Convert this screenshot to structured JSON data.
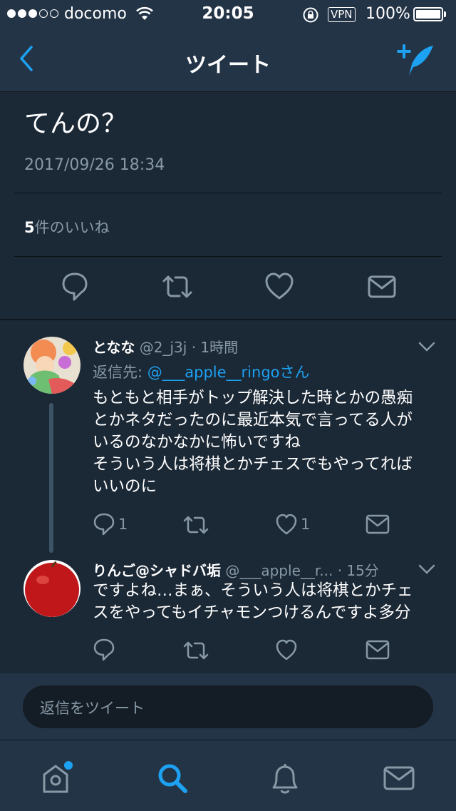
{
  "status_bar": {
    "carrier": "docomo",
    "time": "20:05",
    "vpn": "VPN",
    "battery": "100%",
    "signal_dots_filled": 3,
    "signal_dots_total": 5
  },
  "nav": {
    "title": "ツイート",
    "back_icon": "chevron-left-icon",
    "compose_icon": "compose-tweet-icon"
  },
  "tweet": {
    "text": "てんの？",
    "date": "2017/09/26 18:34",
    "likes_count": "5",
    "likes_label": "件のいいね"
  },
  "replies": [
    {
      "name": "となな",
      "handle": "@2_j3j",
      "time": "· 1時間",
      "reply_to_label": "返信先:",
      "reply_to_user": "@___apple__ringo",
      "reply_to_suffix": "さん",
      "lines": [
        "もともと相手がトップ解決した時とかの愚痴",
        "とかネタだったのに最近本気で言ってる人が",
        "いるのなかなかに怖いですね",
        "そういう人は将棋とかチェスでもやってれば",
        "いいのに"
      ],
      "reply_count": "1",
      "like_count": "1"
    },
    {
      "name": "りんご@シャドバ垢",
      "handle": "@___apple__r...",
      "time": "· 15分",
      "lines": [
        "ですよね…まぁ、そういう人は将棋とかチェ",
        "スをやってもイチャモンつけるんですよ多分"
      ]
    }
  ],
  "composer": {
    "placeholder": "返信をツイート"
  },
  "tabs": [
    {
      "icon": "home-icon"
    },
    {
      "icon": "search-icon"
    },
    {
      "icon": "bell-icon"
    },
    {
      "icon": "mail-icon"
    }
  ],
  "colors": {
    "accent": "#1da1f2",
    "background": "#1b2836",
    "bar": "#243447",
    "muted": "#8899a6"
  }
}
